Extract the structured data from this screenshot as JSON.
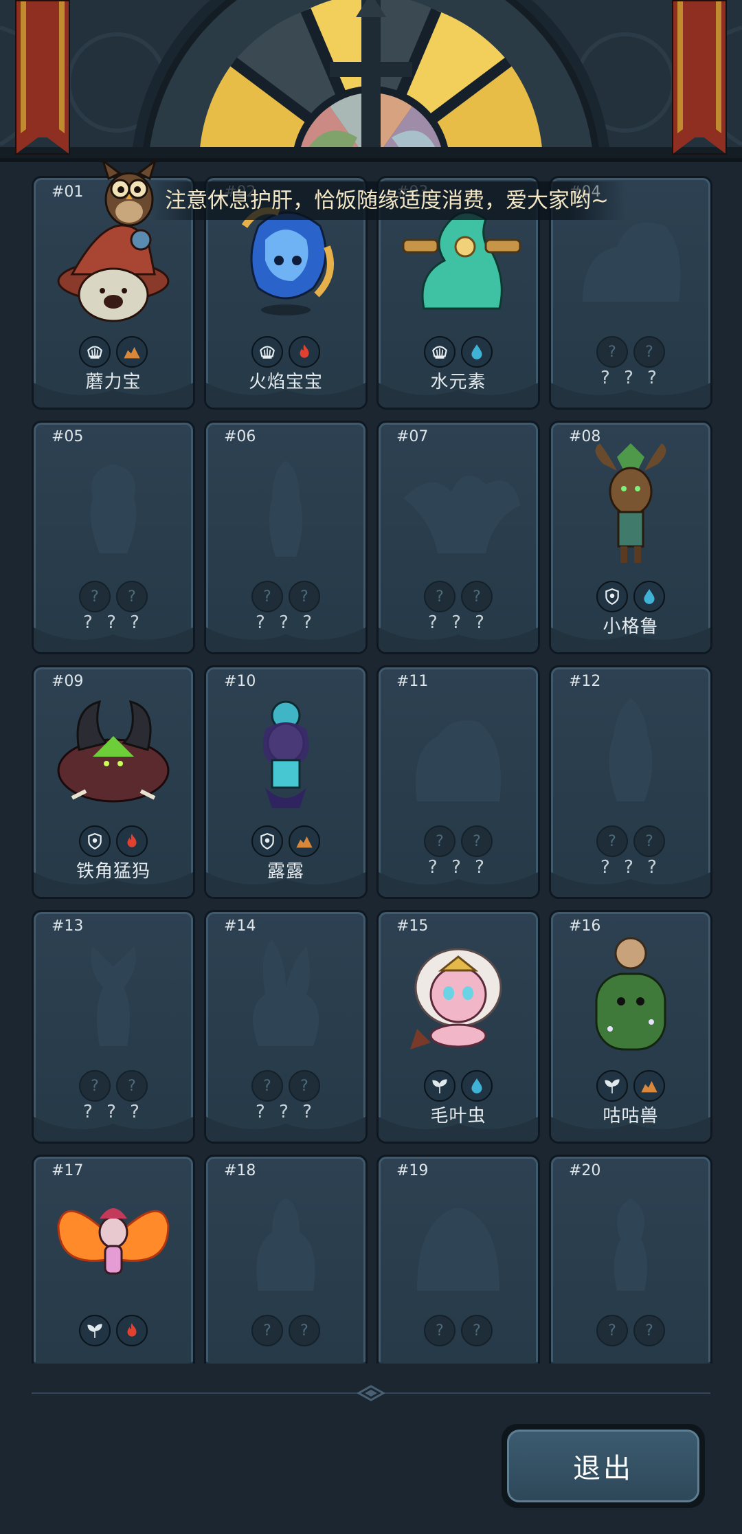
{
  "tip": {
    "text": "注意休息护肝，恰饭随缘适度消费，爱大家哟~"
  },
  "cards": [
    {
      "num": "#01",
      "name": "蘑力宝",
      "known": true,
      "art": "mushroom-monster",
      "badges": [
        "shell",
        "earth"
      ]
    },
    {
      "num": "#02",
      "name": "火焰宝宝",
      "known": true,
      "art": "fire-spirit",
      "badges": [
        "shell",
        "fire"
      ]
    },
    {
      "num": "#03",
      "name": "水元素",
      "known": true,
      "art": "water-elemental",
      "badges": [
        "shell",
        "water"
      ]
    },
    {
      "num": "#04",
      "name": "? ? ?",
      "known": false,
      "art": "silhouette-beast",
      "badges": [
        "unknown",
        "unknown"
      ]
    },
    {
      "num": "#05",
      "name": "? ? ?",
      "known": false,
      "art": "silhouette-imp",
      "badges": [
        "unknown",
        "unknown"
      ]
    },
    {
      "num": "#06",
      "name": "? ? ?",
      "known": false,
      "art": "silhouette-hero",
      "badges": [
        "unknown",
        "unknown"
      ]
    },
    {
      "num": "#07",
      "name": "? ? ?",
      "known": false,
      "art": "silhouette-dragon",
      "badges": [
        "unknown",
        "unknown"
      ]
    },
    {
      "num": "#08",
      "name": "小格鲁",
      "known": true,
      "art": "groot",
      "badges": [
        "shield",
        "water"
      ]
    },
    {
      "num": "#09",
      "name": "铁角猛犸",
      "known": true,
      "art": "iron-mammoth",
      "badges": [
        "shield",
        "fire"
      ]
    },
    {
      "num": "#10",
      "name": "露露",
      "known": true,
      "art": "lulu",
      "badges": [
        "shield",
        "earth"
      ]
    },
    {
      "num": "#11",
      "name": "? ? ?",
      "known": false,
      "art": "silhouette-golem",
      "badges": [
        "unknown",
        "unknown"
      ]
    },
    {
      "num": "#12",
      "name": "? ? ?",
      "known": false,
      "art": "silhouette-spirit",
      "badges": [
        "unknown",
        "unknown"
      ]
    },
    {
      "num": "#13",
      "name": "? ? ?",
      "known": false,
      "art": "silhouette-antler",
      "badges": [
        "unknown",
        "unknown"
      ]
    },
    {
      "num": "#14",
      "name": "? ? ?",
      "known": false,
      "art": "silhouette-rabbit",
      "badges": [
        "unknown",
        "unknown"
      ]
    },
    {
      "num": "#15",
      "name": "毛叶虫",
      "known": true,
      "art": "fluffy-worm",
      "badges": [
        "leaf",
        "water"
      ]
    },
    {
      "num": "#16",
      "name": "咕咕兽",
      "known": true,
      "art": "moss-beast",
      "badges": [
        "leaf",
        "earth"
      ]
    },
    {
      "num": "#17",
      "name": "",
      "known": true,
      "art": "fire-fairy",
      "badges": [
        "leaf",
        "fire"
      ]
    },
    {
      "num": "#18",
      "name": "",
      "known": false,
      "art": "silhouette-knight",
      "badges": [
        "unknown",
        "unknown"
      ]
    },
    {
      "num": "#19",
      "name": "",
      "known": false,
      "art": "silhouette-giant",
      "badges": [
        "unknown",
        "unknown"
      ]
    },
    {
      "num": "#20",
      "name": "",
      "known": false,
      "art": "silhouette-girl",
      "badges": [
        "unknown",
        "unknown"
      ]
    }
  ],
  "exit_button": {
    "label": "退出"
  },
  "colors": {
    "fire": "#e2412f",
    "water": "#3fb2d6",
    "earth": "#d9873a",
    "leaf": "#dfe8ea",
    "shell": "#e9eef0",
    "shield": "#e9eef0"
  }
}
